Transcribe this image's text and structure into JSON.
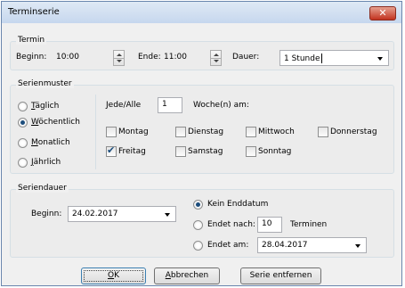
{
  "window": {
    "title": "Terminserie",
    "close_symbol": "✕"
  },
  "termin": {
    "legend": "Termin",
    "beginn_label": "Beginn:",
    "beginn_value": "10:00",
    "ende_label": "Ende:",
    "ende_value": "11:00",
    "dauer_label": "Dauer:",
    "dauer_value": "1 Stunde"
  },
  "serienmuster": {
    "legend": "Serienmuster",
    "options": [
      {
        "label": "Täglich",
        "underline": "T",
        "rest": "äglich",
        "checked": false
      },
      {
        "label": "Wöchentlich",
        "underline": "W",
        "rest": "öchentlich",
        "checked": true
      },
      {
        "label": "Monatlich",
        "underline": "M",
        "rest": "onatlich",
        "checked": false
      },
      {
        "label": "Jährlich",
        "underline": "J",
        "rest": "ährlich",
        "checked": false
      }
    ],
    "jede_label": "Jede/Alle",
    "jede_value": "1",
    "woche_label": "Woche(n) am:",
    "days": [
      {
        "label": "Montag",
        "checked": false
      },
      {
        "label": "Dienstag",
        "checked": false
      },
      {
        "label": "Mittwoch",
        "checked": false
      },
      {
        "label": "Donnerstag",
        "checked": false
      },
      {
        "label": "Freitag",
        "checked": true
      },
      {
        "label": "Samstag",
        "checked": false
      },
      {
        "label": "Sonntag",
        "checked": false
      }
    ]
  },
  "seriendauer": {
    "legend": "Seriendauer",
    "beginn_label": "Beginn:",
    "beginn_value": "24.02.2017",
    "kein_enddatum": "Kein Enddatum",
    "endet_nach_label": "Endet nach:",
    "endet_nach_value": "10",
    "termine_label": "Terminen",
    "endet_am_label": "Endet am:",
    "endet_am_value": "28.04.2017",
    "selected": "kein_enddatum"
  },
  "buttons": {
    "ok_u": "O",
    "ok_rest": "K",
    "abbrechen_u": "A",
    "abbrechen_rest": "bbrechen",
    "serie_entfernen": "Serie entfernen"
  }
}
